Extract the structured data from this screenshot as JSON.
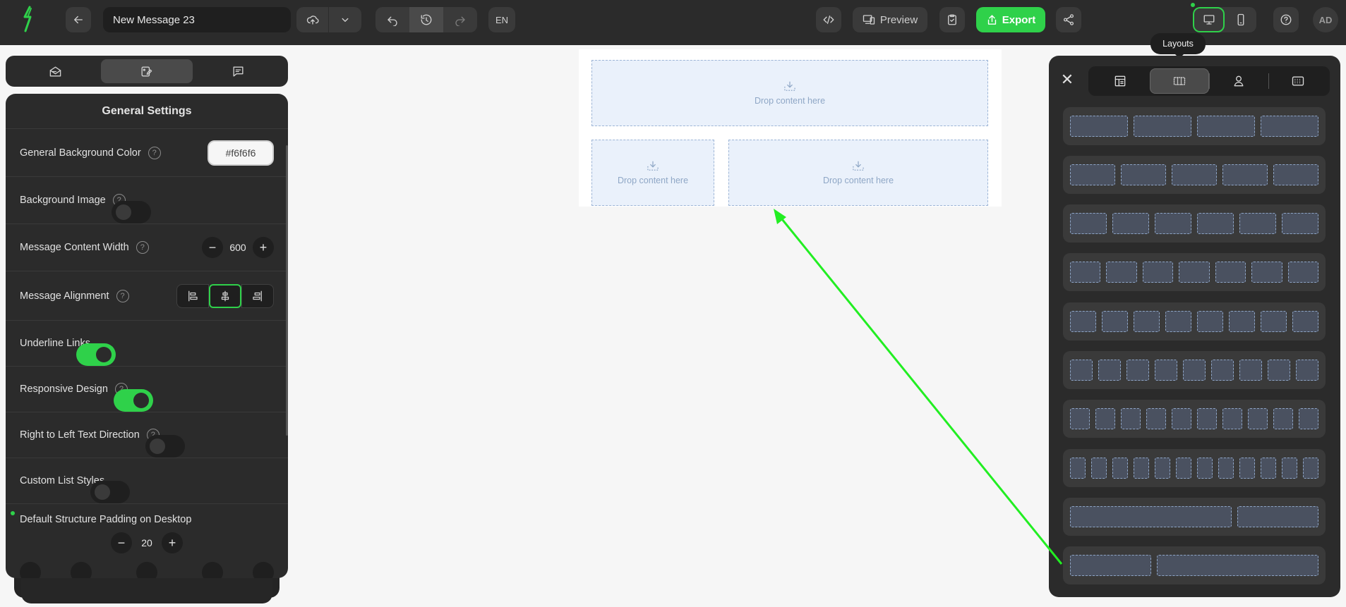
{
  "app": {
    "brand_icon": "lightning-logo",
    "accent_color": "#2fd14a",
    "canvas_background": "#f6f6f6"
  },
  "toolbar": {
    "back_icon": "arrow-left-icon",
    "message_title": "New Message 23",
    "save_icon": "cloud-upload-icon",
    "save_menu_icon": "chevron-down-icon",
    "undo_icon": "undo-icon",
    "history_icon": "history-icon",
    "redo_icon": "redo-icon",
    "language": "EN",
    "code_icon": "code-icon",
    "preview_label": "Preview",
    "test_icon": "clipboard-check-icon",
    "export_label": "Export",
    "share_icon": "share-icon",
    "desktop_icon": "desktop-icon",
    "mobile_icon": "mobile-icon",
    "help_icon": "help-icon",
    "avatar_initials": "AD"
  },
  "left_tabs": [
    {
      "name": "content-blocks",
      "icon": "envelope-open-icon"
    },
    {
      "name": "appearance",
      "icon": "palette-icon"
    },
    {
      "name": "comments",
      "icon": "chat-icon"
    }
  ],
  "settings": {
    "title": "General Settings",
    "background_color": {
      "label": "General Background Color",
      "value": "#f6f6f6",
      "display": "#f6f6f6"
    },
    "background_image": {
      "label": "Background Image",
      "on": false
    },
    "content_width": {
      "label": "Message Content Width",
      "value": "600",
      "minus": "−",
      "plus": "+"
    },
    "alignment": {
      "label": "Message Alignment",
      "selected": "center"
    },
    "underline_links": {
      "label": "Underline Links",
      "on": true
    },
    "responsive": {
      "label": "Responsive Design",
      "on": true
    },
    "rtl": {
      "label": "Right to Left Text Direction",
      "on": false
    },
    "custom_lists": {
      "label": "Custom List Styles",
      "on": false
    },
    "structure_padding": {
      "label": "Default Structure Padding on Desktop",
      "value": "20",
      "minus": "−",
      "plus": "+"
    },
    "help_glyph": "?"
  },
  "canvas": {
    "drop_label": "Drop content here"
  },
  "right_panel": {
    "tooltip": "Layouts",
    "close_glyph": "✕",
    "tabs": [
      {
        "name": "blocks",
        "icon": "blocks-icon"
      },
      {
        "name": "layouts",
        "icon": "layouts-icon",
        "active": true
      },
      {
        "name": "modules",
        "icon": "person-icon"
      },
      {
        "name": "saved",
        "icon": "grid-icon"
      }
    ],
    "layouts": [
      {
        "columns": [
          1,
          1,
          1,
          1
        ]
      },
      {
        "columns": [
          1,
          1,
          1,
          1,
          1
        ]
      },
      {
        "columns": [
          1,
          1,
          1,
          1,
          1,
          1
        ]
      },
      {
        "columns": [
          1,
          1,
          1,
          1,
          1,
          1,
          1
        ]
      },
      {
        "columns": [
          1,
          1,
          1,
          1,
          1,
          1,
          1,
          1
        ]
      },
      {
        "columns": [
          1,
          1,
          1,
          1,
          1,
          1,
          1,
          1,
          1
        ]
      },
      {
        "columns": [
          1,
          1,
          1,
          1,
          1,
          1,
          1,
          1,
          1,
          1
        ]
      },
      {
        "columns": [
          1,
          1,
          1,
          1,
          1,
          1,
          1,
          1,
          1,
          1,
          1,
          1
        ]
      },
      {
        "columns": [
          2,
          1
        ]
      },
      {
        "columns": [
          1,
          2
        ]
      }
    ]
  }
}
